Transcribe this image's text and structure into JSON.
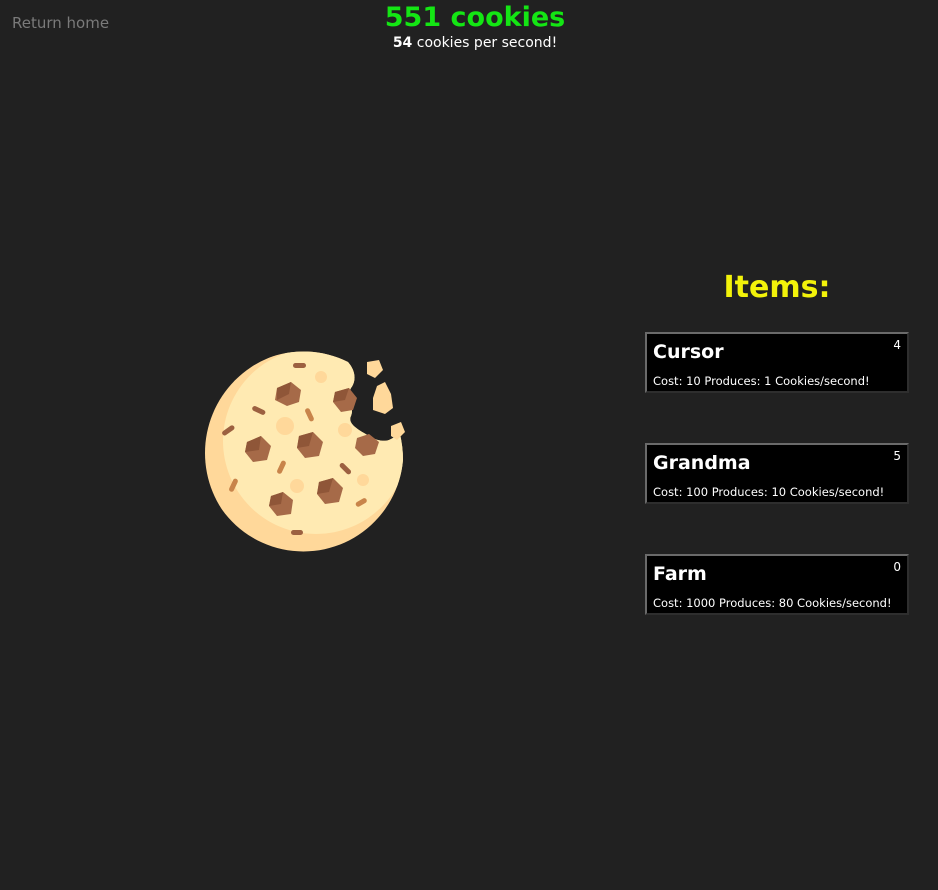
{
  "nav": {
    "return_home": "Return home"
  },
  "stats": {
    "cookies_text": "551 cookies",
    "cookies_per_second": "54",
    "cps_suffix": " cookies per second!"
  },
  "cookie": {
    "icon": "cookie-icon"
  },
  "shop": {
    "title": "Items:",
    "items": [
      {
        "name": "Cursor",
        "owned": "4",
        "info": "Cost: 10 Produces: 1 Cookies/second!"
      },
      {
        "name": "Grandma",
        "owned": "5",
        "info": "Cost: 100 Produces: 10 Cookies/second!"
      },
      {
        "name": "Farm",
        "owned": "0",
        "info": "Cost: 1000 Produces: 80 Cookies/second!"
      }
    ]
  },
  "colors": {
    "background": "#212121",
    "cookie_count": "#14e614",
    "items_title": "#f2f20a",
    "item_card": "#000000"
  }
}
